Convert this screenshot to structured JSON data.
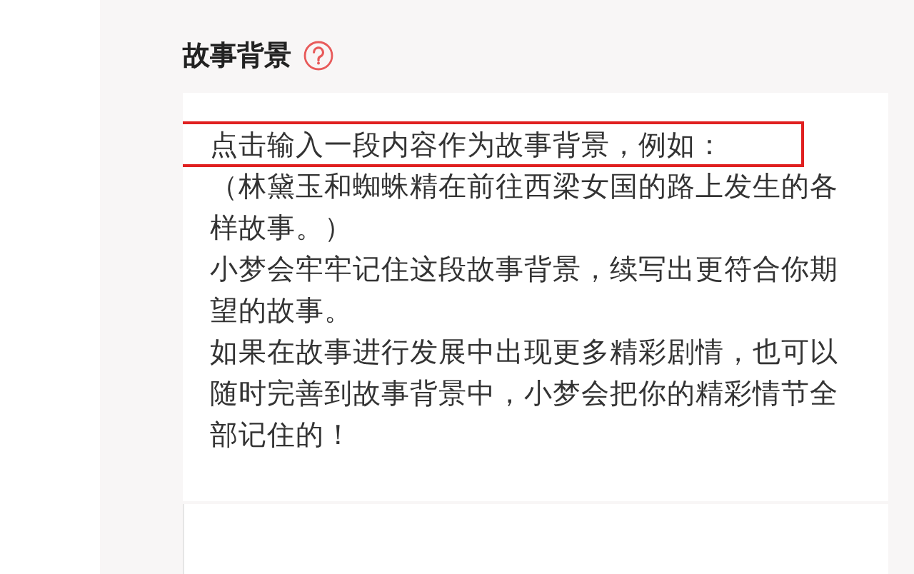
{
  "section": {
    "title": "故事背景",
    "field": {
      "placeholder": [
        "点击输入一段内容作为故事背景，例如：",
        "（林黛玉和蜘蛛精在前往西梁女国的路上发生的各样故事。）",
        "小梦会牢牢记住这段故事背景，续写出更符合你期望的故事。",
        "如果在故事进行发展中出现更多精彩剧情，也可以随时完善到故事背景中，小梦会把你的精彩情节全部记住的！"
      ]
    }
  }
}
